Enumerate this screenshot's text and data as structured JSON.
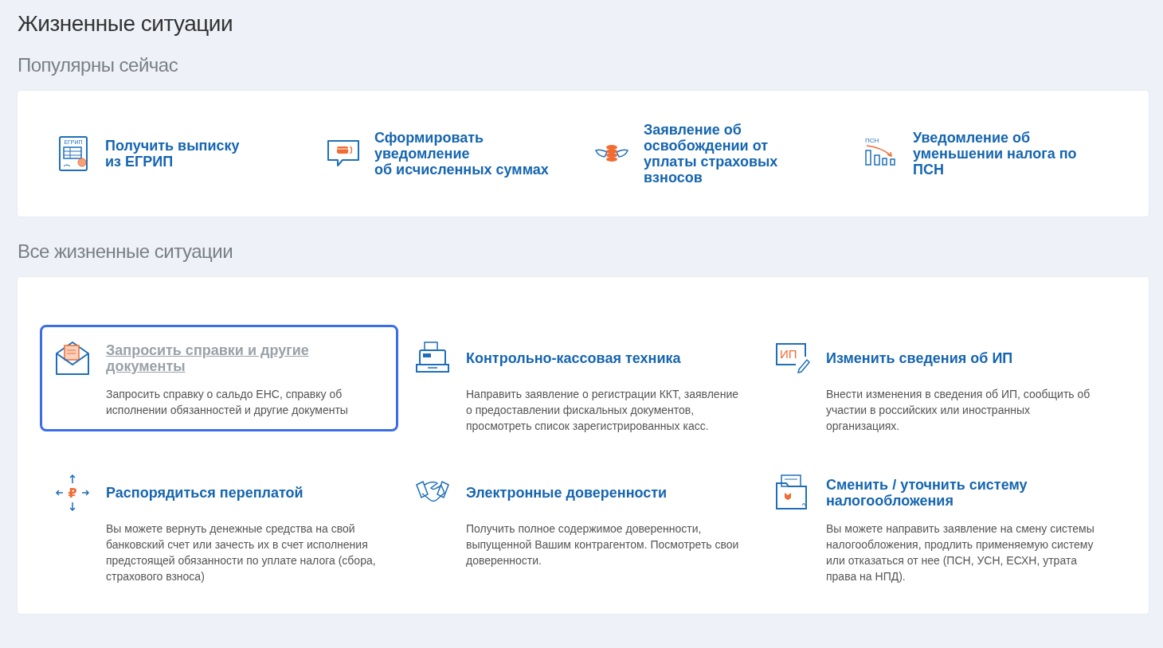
{
  "page_title": "Жизненные ситуации",
  "popular": {
    "heading": "Популярны сейчас",
    "items": [
      {
        "kind": "egrip",
        "icon_text": "ЕГРИП",
        "title": "Получить выписку\nиз ЕГРИП"
      },
      {
        "kind": "message",
        "title": "Сформировать\nуведомление\nоб исчисленных суммах"
      },
      {
        "kind": "coins",
        "title": "Заявление об\nосвобождении от\nуплаты страховых\nвзносов"
      },
      {
        "kind": "psn",
        "icon_text": "ПСН",
        "title": "Уведомление об\nуменьшении налога по\nПСН"
      }
    ]
  },
  "all": {
    "heading": "Все жизненные ситуации",
    "items": [
      {
        "kind": "envelope",
        "selected": true,
        "title": "Запросить справки и другие документы",
        "description": "Запросить справку о сальдо ЕНС, справку об исполнении обязанностей и другие документы"
      },
      {
        "kind": "register",
        "selected": false,
        "title": "Контрольно-кассовая техника",
        "description": "Направить заявление о регистрации ККТ, заявление о предоставлении фискальных документов, просмотреть список зарегистрированных касс."
      },
      {
        "kind": "ip",
        "selected": false,
        "icon_text": "ИП",
        "title": "Изменить сведения об ИП",
        "description": "Внести изменения в сведения об ИП, сообщить об участии в российских или иностранных организациях."
      },
      {
        "kind": "ruble",
        "selected": false,
        "icon_text": "₽",
        "title": "Распорядиться переплатой",
        "description": "Вы можете вернуть денежные средства на свой банковский счет или зачесть их в счет исполнения предстоящей обязанности по уплате налога (сбора, страхового взноса)"
      },
      {
        "kind": "handshake",
        "selected": false,
        "title": "Электронные доверенности",
        "description": "Получить полное содержимое доверенности, выпущенной Вашим контрагентом. Посмотреть свои доверенности."
      },
      {
        "kind": "folder",
        "selected": false,
        "title": "Сменить / уточнить систему налогообложения",
        "description": "Вы можете направить заявление на смену системы налогообложения, продлить применяемую систему или отказаться от нее (ПСН, УСН, ЕСХН, утрата права на НПД)."
      }
    ]
  }
}
